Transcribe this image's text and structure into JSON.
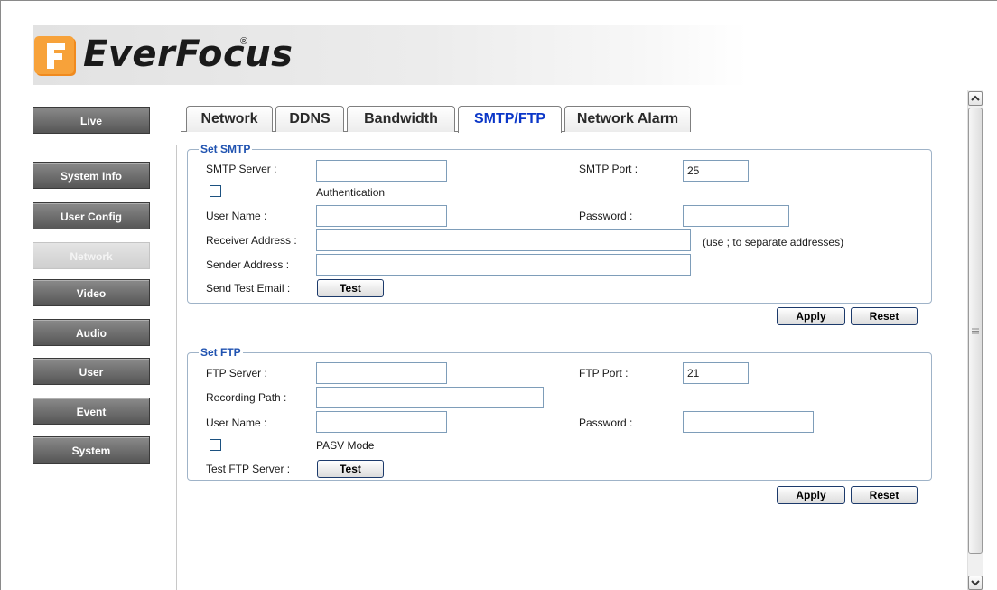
{
  "logo": {
    "text": "EverFocus",
    "reg": "®"
  },
  "sidebar": {
    "items": [
      {
        "label": "Live"
      },
      {
        "label": "System Info"
      },
      {
        "label": "User Config"
      },
      {
        "label": "Network"
      },
      {
        "label": "Video"
      },
      {
        "label": "Audio"
      },
      {
        "label": "User"
      },
      {
        "label": "Event"
      },
      {
        "label": "System"
      }
    ],
    "active": "Network"
  },
  "tabs": [
    {
      "label": "Network"
    },
    {
      "label": "DDNS"
    },
    {
      "label": "Bandwidth"
    },
    {
      "label": "SMTP/FTP"
    },
    {
      "label": "Network Alarm"
    }
  ],
  "active_tab": "SMTP/FTP",
  "smtp": {
    "legend": "Set SMTP",
    "server_label": "SMTP Server :",
    "server_value": "",
    "port_label": "SMTP Port :",
    "port_value": "25",
    "auth_label": "Authentication",
    "user_label": "User Name :",
    "user_value": "",
    "password_label": "Password :",
    "password_value": "",
    "receiver_label": "Receiver Address :",
    "receiver_value": "",
    "receiver_hint": "(use ; to separate addresses)",
    "sender_label": "Sender Address :",
    "sender_value": "",
    "test_label": "Send Test Email :",
    "test_button": "Test",
    "apply_button": "Apply",
    "reset_button": "Reset"
  },
  "ftp": {
    "legend": "Set FTP",
    "server_label": "FTP Server :",
    "server_value": "",
    "port_label": "FTP Port :",
    "port_value": "21",
    "path_label": "Recording Path :",
    "path_value": "",
    "user_label": "User Name :",
    "user_value": "",
    "password_label": "Password :",
    "password_value": "",
    "pasv_label": "PASV Mode",
    "test_label": "Test FTP Server :",
    "test_button": "Test",
    "apply_button": "Apply",
    "reset_button": "Reset"
  },
  "colors": {
    "sidebar_button": "#6e6e6e",
    "sidebar_active": "#d9d9d9",
    "active_tab_text": "#0b37c8",
    "legend_text": "#1f52b0",
    "logo_orange": "#f08a1e"
  }
}
